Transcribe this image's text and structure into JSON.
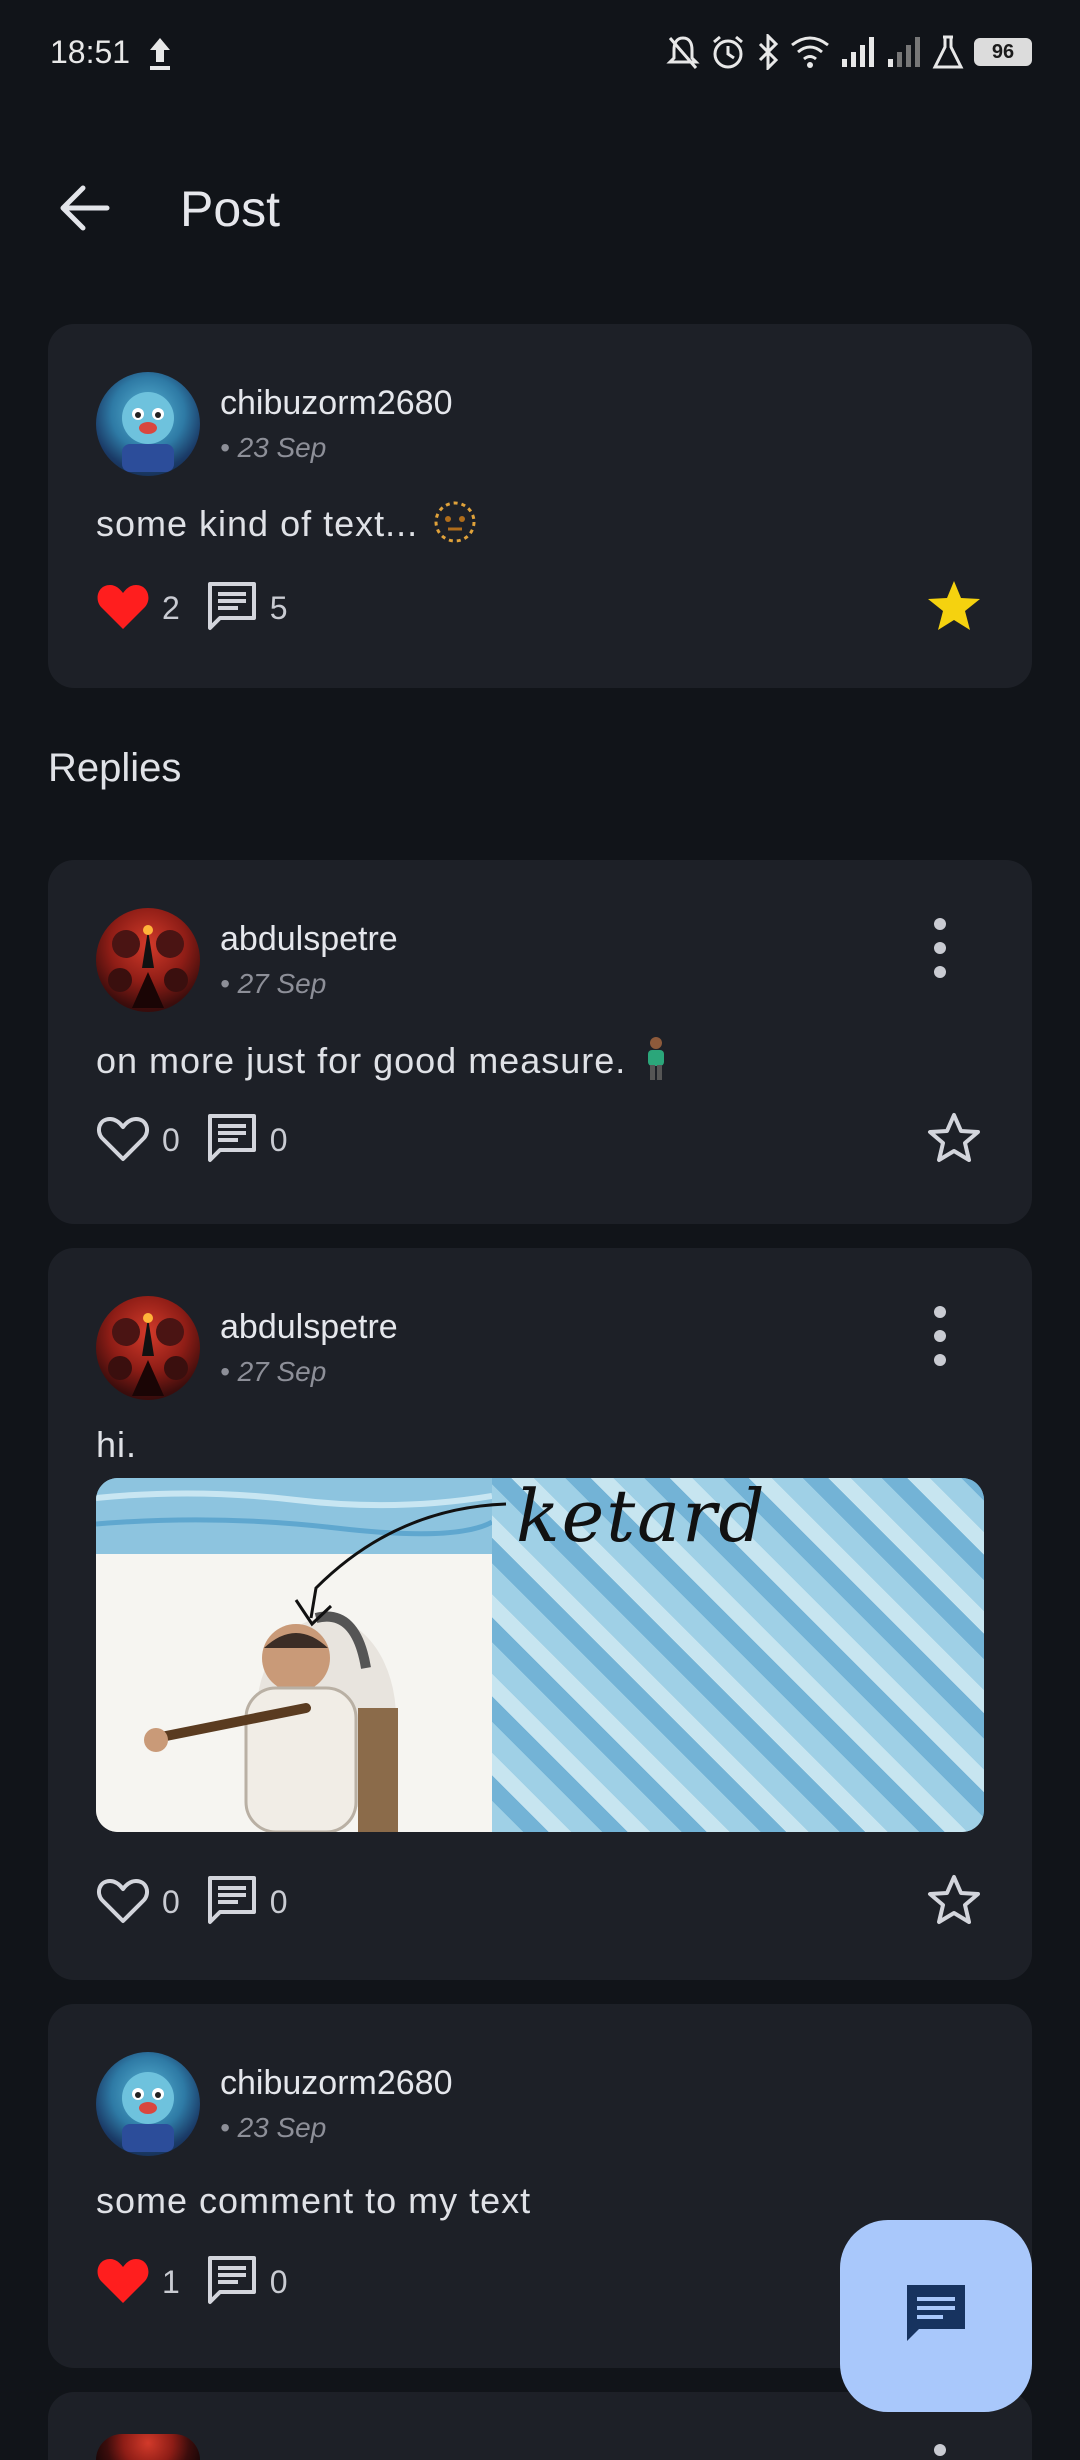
{
  "status_bar": {
    "time": "18:51",
    "battery": "96"
  },
  "app_bar": {
    "title": "Post"
  },
  "post": {
    "username": "chibuzorm2680",
    "date": "• 23 Sep",
    "text": "some kind of text...",
    "likes": "2",
    "comments": "5",
    "liked": true,
    "starred": true
  },
  "replies_title": "Replies",
  "replies": [
    {
      "username": "abdulspetre",
      "date": "• 27 Sep",
      "text": "on more just for good measure.",
      "likes": "0",
      "comments": "0"
    },
    {
      "username": "abdulspetre",
      "date": "• 27 Sep",
      "text": "hi.",
      "likes": "0",
      "comments": "0",
      "image_caption": "ketard"
    },
    {
      "username": "chibuzorm2680",
      "date": "• 23 Sep",
      "text": "some comment to my text",
      "likes": "1",
      "comments": "0"
    }
  ],
  "colors": {
    "background": "#111419",
    "card": "#1d2027",
    "like_active": "#ff1e1e",
    "star_active": "#f5d20f",
    "fab": "#a9c8fb"
  },
  "icons": {
    "back": "arrow-left-icon",
    "like": "heart-icon",
    "comment": "comment-icon",
    "star": "star-icon",
    "more": "more-vert-icon",
    "fab": "chat-icon"
  }
}
